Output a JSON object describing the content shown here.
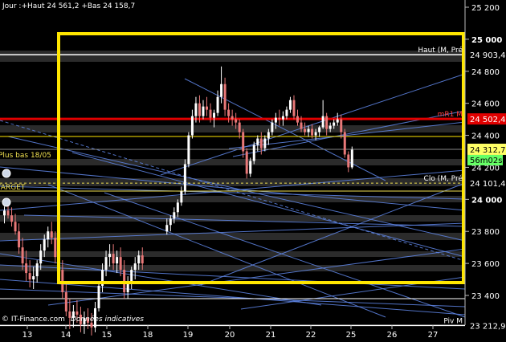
{
  "header": {
    "text": "Jour :+Haut 24 561,2 +Bas 24 158,7"
  },
  "footer": {
    "credit": "© IT-Finance.com",
    "note": "Données indicatives"
  },
  "colors": {
    "background": "#000000",
    "up_candle": "#ffffff",
    "down_candle": "#e87878",
    "focus_box": "#ffe600",
    "resistance": "#e00000",
    "dashed_level": "#f0e050",
    "trendline": "#5f86e6",
    "price_badge": "#ffff66",
    "timer_badge": "#66ff66"
  },
  "chart_data": {
    "type": "candlestick",
    "ylim": [
      23120,
      25220
    ],
    "y_ticks": [
      {
        "value": 25200,
        "label": "25 200",
        "bold": false
      },
      {
        "value": 25000,
        "label": "25 000",
        "bold": true
      },
      {
        "value": 24800,
        "label": "24 800",
        "bold": false
      },
      {
        "value": 24600,
        "label": "24 600",
        "bold": false
      },
      {
        "value": 24400,
        "label": "24 400",
        "bold": false
      },
      {
        "value": 24200,
        "label": "24 200",
        "bold": false
      },
      {
        "value": 24000,
        "label": "24 000",
        "bold": true
      },
      {
        "value": 23800,
        "label": "23 800",
        "bold": false
      },
      {
        "value": 23600,
        "label": "23 600",
        "bold": false
      },
      {
        "value": 23400,
        "label": "23 400",
        "bold": false
      }
    ],
    "x_ticks": [
      "13",
      "14",
      "15",
      "18",
      "19",
      "20",
      "21",
      "22",
      "25",
      "26",
      "27"
    ],
    "levels": [
      {
        "value": 24903.4,
        "value_label": "24 903,4",
        "name": "Haut (M, Pré",
        "kind": "white"
      },
      {
        "value": 24502.4,
        "value_label": "24 502,4",
        "name": "mR1 M",
        "kind": "red"
      },
      {
        "value": 24312.7,
        "value_label": "24 312,7",
        "name": "",
        "kind": "last"
      },
      {
        "value": 24101.4,
        "value_label": "24 101,4",
        "name": "Clo (M, Pré",
        "kind": "dashed"
      },
      {
        "value": 23212.9,
        "value_label": "23 212,9",
        "name": "Piv M",
        "kind": "white"
      }
    ],
    "timer": "56m02s",
    "annotations": [
      {
        "text": "Plus bas 18/05",
        "color": "#f0e050"
      },
      {
        "text": "TARGET",
        "color": "#f0e050"
      }
    ],
    "candles": [
      [
        23900,
        23955,
        23850,
        23930
      ],
      [
        23930,
        23975,
        23880,
        23900
      ],
      [
        23900,
        23950,
        23830,
        23860
      ],
      [
        23860,
        23910,
        23780,
        23800
      ],
      [
        23800,
        23850,
        23660,
        23700
      ],
      [
        23700,
        23760,
        23560,
        23600
      ],
      [
        23600,
        23680,
        23490,
        23540
      ],
      [
        23540,
        23620,
        23450,
        23500
      ],
      [
        23500,
        23580,
        23440,
        23520
      ],
      [
        23520,
        23620,
        23480,
        23600
      ],
      [
        23600,
        23720,
        23560,
        23680
      ],
      [
        23680,
        23780,
        23640,
        23750
      ],
      [
        23750,
        23830,
        23700,
        23800
      ],
      [
        23800,
        23860,
        23720,
        23760
      ],
      [
        23760,
        23800,
        23600,
        23640
      ],
      [
        23640,
        23700,
        23500,
        23560
      ],
      [
        23560,
        23620,
        23380,
        23420
      ],
      [
        23420,
        23480,
        23270,
        23300
      ],
      [
        23300,
        23380,
        23190,
        23260
      ],
      [
        23260,
        23340,
        23200,
        23300
      ],
      [
        23300,
        23370,
        23230,
        23280
      ],
      [
        23280,
        23330,
        23170,
        23220
      ],
      [
        23220,
        23300,
        23160,
        23260
      ],
      [
        23260,
        23320,
        23190,
        23230
      ],
      [
        23230,
        23290,
        23150,
        23200
      ],
      [
        23200,
        23360,
        23170,
        23320
      ],
      [
        23320,
        23480,
        23300,
        23460
      ],
      [
        23460,
        23600,
        23420,
        23560
      ],
      [
        23560,
        23680,
        23520,
        23640
      ],
      [
        23640,
        23720,
        23580,
        23660
      ],
      [
        23660,
        23720,
        23560,
        23600
      ],
      [
        23600,
        23680,
        23540,
        23640
      ],
      [
        23640,
        23700,
        23520,
        23560
      ],
      [
        23560,
        23620,
        23380,
        23420
      ],
      [
        23420,
        23520,
        23380,
        23480
      ],
      [
        23480,
        23580,
        23440,
        23560
      ],
      [
        23560,
        23640,
        23500,
        23600
      ],
      [
        23600,
        23680,
        23560,
        23650
      ],
      [
        23650,
        23700,
        23560,
        23600
      ],
      [
        23800,
        23880,
        23780,
        23840
      ],
      [
        23840,
        23900,
        23800,
        23880
      ],
      [
        23880,
        23950,
        23850,
        23920
      ],
      [
        23920,
        24000,
        23890,
        23980
      ],
      [
        23980,
        24080,
        23960,
        24050
      ],
      [
        24050,
        24250,
        24030,
        24220
      ],
      [
        24220,
        24420,
        24200,
        24400
      ],
      [
        24400,
        24560,
        24380,
        24520
      ],
      [
        24520,
        24640,
        24480,
        24600
      ],
      [
        24600,
        24650,
        24480,
        24520
      ],
      [
        24520,
        24620,
        24500,
        24580
      ],
      [
        24580,
        24640,
        24520,
        24560
      ],
      [
        24560,
        24600,
        24480,
        24510
      ],
      [
        24510,
        24560,
        24450,
        24540
      ],
      [
        24540,
        24680,
        24520,
        24640
      ],
      [
        24640,
        24830,
        24600,
        24720
      ],
      [
        24720,
        24760,
        24520,
        24560
      ],
      [
        24560,
        24600,
        24480,
        24520
      ],
      [
        24520,
        24560,
        24460,
        24500
      ],
      [
        24500,
        24540,
        24440,
        24480
      ],
      [
        24480,
        24500,
        24380,
        24420
      ],
      [
        24420,
        24440,
        24260,
        24300
      ],
      [
        24300,
        24320,
        24130,
        24160
      ],
      [
        24160,
        24260,
        24140,
        24240
      ],
      [
        24240,
        24360,
        24220,
        24340
      ],
      [
        24340,
        24400,
        24300,
        24380
      ],
      [
        24380,
        24420,
        24280,
        24320
      ],
      [
        24320,
        24400,
        24300,
        24380
      ],
      [
        24380,
        24440,
        24340,
        24420
      ],
      [
        24420,
        24500,
        24400,
        24480
      ],
      [
        24480,
        24540,
        24440,
        24510
      ],
      [
        24510,
        24560,
        24460,
        24500
      ],
      [
        24500,
        24550,
        24460,
        24520
      ],
      [
        24520,
        24580,
        24500,
        24560
      ],
      [
        24560,
        24640,
        24540,
        24620
      ],
      [
        24620,
        24650,
        24500,
        24520
      ],
      [
        24520,
        24560,
        24460,
        24480
      ],
      [
        24480,
        24520,
        24420,
        24440
      ],
      [
        24440,
        24480,
        24400,
        24420
      ],
      [
        24420,
        24460,
        24390,
        24440
      ],
      [
        24440,
        24470,
        24380,
        24400
      ],
      [
        24400,
        24440,
        24370,
        24420
      ],
      [
        24420,
        24460,
        24390,
        24450
      ],
      [
        24450,
        24620,
        24440,
        24520
      ],
      [
        24520,
        24540,
        24400,
        24440
      ],
      [
        24440,
        24480,
        24420,
        24460
      ],
      [
        24460,
        24500,
        24440,
        24480
      ],
      [
        24480,
        24540,
        24460,
        24500
      ],
      [
        24500,
        24530,
        24380,
        24420
      ],
      [
        24420,
        24440,
        24260,
        24280
      ],
      [
        24280,
        24300,
        24170,
        24200
      ],
      [
        24200,
        24330,
        24190,
        24310
      ]
    ]
  }
}
